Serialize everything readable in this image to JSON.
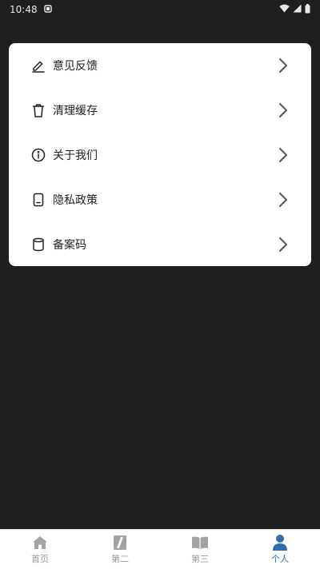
{
  "status_bar": {
    "time": "10:48"
  },
  "menu": {
    "items": [
      {
        "label": "意见反馈",
        "icon": "edit-icon"
      },
      {
        "label": "清理缓存",
        "icon": "trash-icon"
      },
      {
        "label": "关于我们",
        "icon": "info-icon"
      },
      {
        "label": "隐私政策",
        "icon": "document-icon"
      },
      {
        "label": "备案码",
        "icon": "cylinder-icon"
      }
    ]
  },
  "bottom_nav": {
    "items": [
      {
        "label": "首页",
        "icon": "home-icon",
        "active": false
      },
      {
        "label": "第二",
        "icon": "bookmark-icon",
        "active": false
      },
      {
        "label": "第三",
        "icon": "book-icon",
        "active": false
      },
      {
        "label": "个人",
        "icon": "person-icon",
        "active": true
      }
    ]
  },
  "colors": {
    "background": "#1f1f22",
    "card": "#ffffff",
    "accent": "#2e6db4",
    "inactive": "#9a9a9a"
  }
}
